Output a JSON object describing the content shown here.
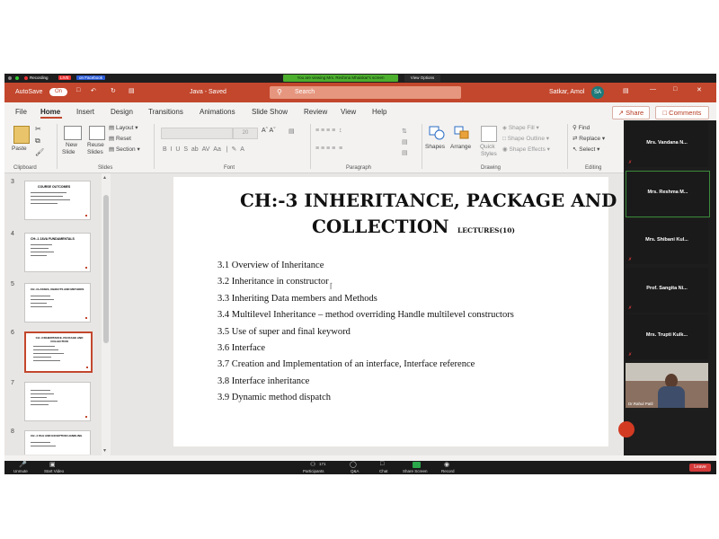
{
  "zoom_top": {
    "recording": "Recording",
    "live": "LIVE",
    "live_on": "on Facebook",
    "viewing_banner": "You are viewing Mrs. Reshma Mhaiskar's screen",
    "view_options": "View Options"
  },
  "titlebar": {
    "autosave": "AutoSave",
    "toggle": "On",
    "file_name": "Java - Saved",
    "search_placeholder": "Search",
    "user_name": "Satkar, Amol",
    "user_initials": "SA"
  },
  "tabs": [
    "File",
    "Home",
    "Insert",
    "Design",
    "Transitions",
    "Animations",
    "Slide Show",
    "Review",
    "View",
    "Help"
  ],
  "share_label": "Share",
  "comments_label": "Comments",
  "ribbon": {
    "paste": "Paste",
    "new_slide": "New",
    "new_slide2": "Slide",
    "reuse": "Reuse",
    "reuse2": "Slides",
    "layout": "Layout",
    "reset": "Reset",
    "section": "Section",
    "font_size": "20",
    "shapes": "Shapes",
    "arrange": "Arrange",
    "quick": "Quick",
    "styles": "Styles",
    "shape_fill": "Shape Fill",
    "shape_outline": "Shape Outline",
    "shape_effects": "Shape Effects",
    "find": "Find",
    "replace": "Replace",
    "select": "Select",
    "groups": [
      "Clipboard",
      "Slides",
      "Font",
      "Paragraph",
      "Drawing",
      "Editing"
    ]
  },
  "thumbs": [
    {
      "num": "3",
      "title": "COURSE OUTCOMES"
    },
    {
      "num": "4",
      "title": "CH:-1 JAVA FUNDAMENTALS"
    },
    {
      "num": "5",
      "title": "CH:-CLASSES, OBJECTS AND METHODS"
    },
    {
      "num": "6",
      "title": "CH:-3 INHERITANCE, PACKAGE AND COLLECTION"
    },
    {
      "num": "7",
      "title": ""
    },
    {
      "num": "8",
      "title": "CH:-4 FILE AND EXCEPTION HANDLING"
    }
  ],
  "slide": {
    "title_line1": "CH:-3 INHERITANCE, PACKAGE AND",
    "title_line2": "COLLECTION",
    "lectures": "LECTURES(10)",
    "items": [
      "3.1 Overview of Inheritance",
      "3.2 Inheritance in constructor",
      "3.3 Inheriting Data members and Methods",
      "3.4 Multilevel Inheritance – method overriding Handle multilevel constructors",
      "3.5 Use of super and final keyword",
      "3.6 Interface",
      "3.7 Creation and Implementation of an interface, Interface reference",
      "3.8 Interface inheritance",
      "3.9 Dynamic method dispatch"
    ]
  },
  "participants": [
    "Mrs. Vandana N...",
    "Mrs. Reshma M...",
    "Mrs. Shibani Kul...",
    "Prof. Sangita Ni...",
    "Mrs. Trupti Kulk..."
  ],
  "video_name": "Dr.Rahul Patil",
  "zoom_bottom": {
    "unmute": "Unmute",
    "start_video": "Start Video",
    "participants": "Participants",
    "participants_count": "171",
    "qa": "Q&A",
    "chat": "Chat",
    "share_screen": "Share Screen",
    "record": "Record",
    "leave": "Leave"
  }
}
